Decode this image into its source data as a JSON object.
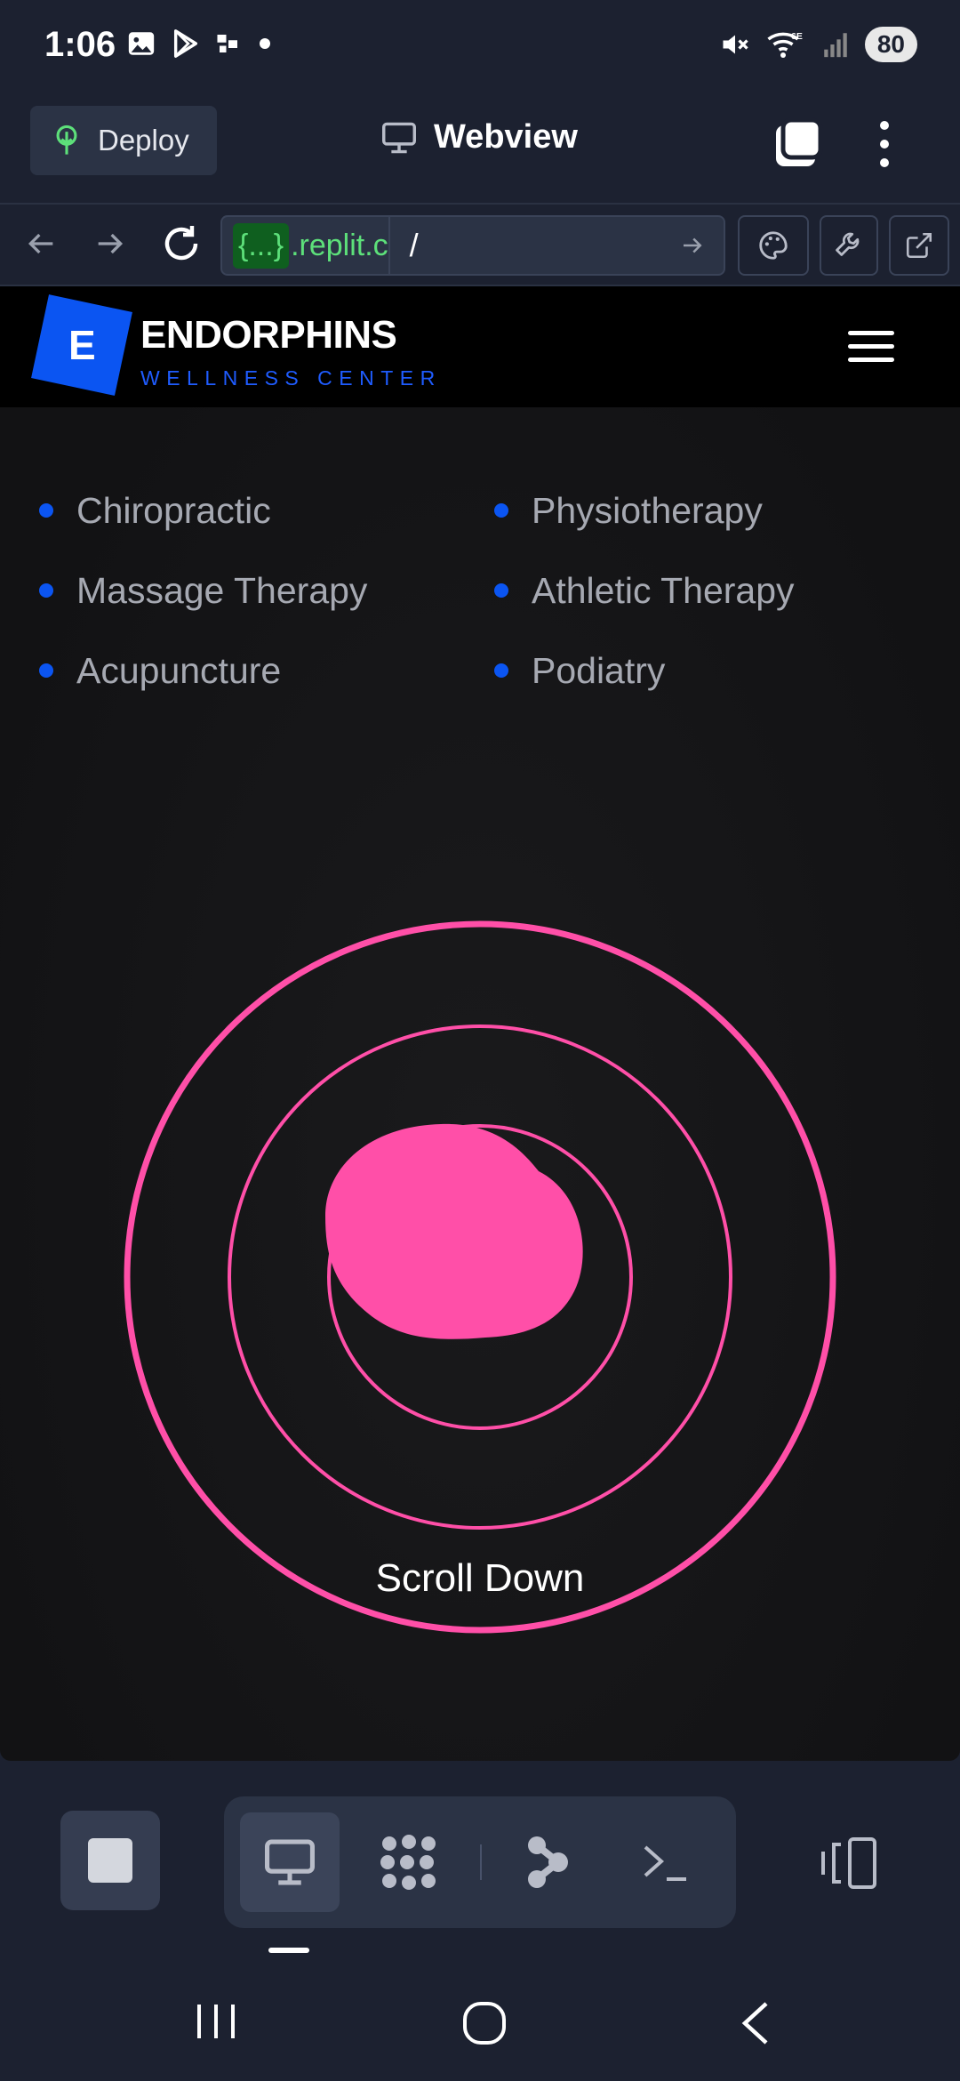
{
  "status_bar": {
    "time": "1:06",
    "battery": "80"
  },
  "app_header": {
    "deploy_label": "Deploy",
    "webview_label": "Webview"
  },
  "url_bar": {
    "badge": "{...}",
    "host": ".replit.c",
    "path": "/"
  },
  "site": {
    "logo_letter": "E",
    "brand_name": "ENDORPHINS",
    "brand_tagline": "WELLNESS CENTER",
    "services": [
      "Chiropractic",
      "Physiotherapy",
      "Massage Therapy",
      "Athletic Therapy",
      "Acupuncture",
      "Podiatry"
    ],
    "scroll_label": "Scroll Down"
  },
  "colors": {
    "app_bg": "#1c2130",
    "brand_blue": "#0b55f2",
    "accent_pink": "#ff4fa8",
    "url_green": "#5de07a"
  },
  "icons": {
    "status_left": [
      "gallery-icon",
      "play-store-icon",
      "app-icon",
      "dot-icon"
    ],
    "status_right": [
      "mute-icon",
      "wifi-6e-icon",
      "signal-icon"
    ],
    "bottom_tools": [
      "webview-icon",
      "workspace-icon",
      "git-icon",
      "shell-icon"
    ]
  }
}
